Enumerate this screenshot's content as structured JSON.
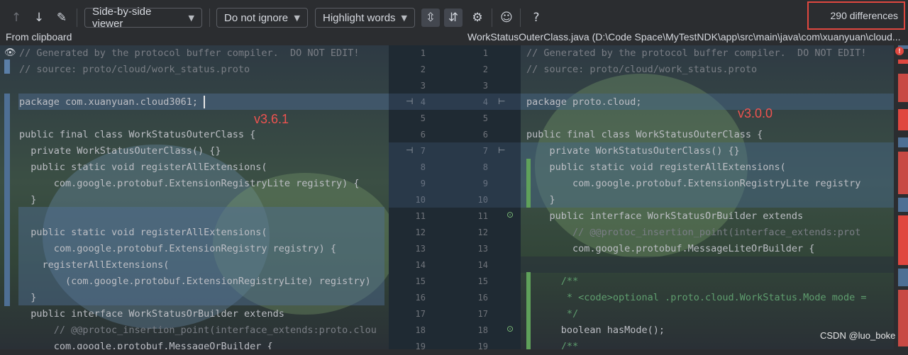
{
  "toolbar": {
    "prev_icon": "arrow-up-icon",
    "next_icon": "arrow-down-icon",
    "edit_icon": "pencil-icon",
    "viewer_mode": "Side-by-side viewer",
    "ignore_mode": "Do not ignore",
    "highlight_mode": "Highlight words",
    "collapse_icon": "collapse-unchanged-icon",
    "sync_scroll_icon": "sync-scroll-icon",
    "settings_icon": "gear-icon",
    "annotate_icon": "annotate-icon",
    "help_label": "?"
  },
  "differences_label": "290 differences",
  "left_header": "From clipboard",
  "right_header": "WorkStatusOuterClass.java (D:\\Code Space\\MyTestNDK\\app\\src\\main\\java\\com\\xuanyuan\\cloud...",
  "left_version": "v3.6.1",
  "right_version": "v3.0.0",
  "left_lines": [
    "// Generated by the protocol buffer compiler.  DO NOT EDIT!",
    "// source: proto/cloud/work_status.proto",
    "",
    "package com.xuanyuan.cloud3061;",
    "",
    "public final class WorkStatusOuterClass {",
    "  private WorkStatusOuterClass() {}",
    "  public static void registerAllExtensions(",
    "      com.google.protobuf.ExtensionRegistryLite registry) {",
    "  }",
    "",
    "  public static void registerAllExtensions(",
    "      com.google.protobuf.ExtensionRegistry registry) {",
    "    registerAllExtensions(",
    "        (com.google.protobuf.ExtensionRegistryLite) registry)",
    "  }",
    "  public interface WorkStatusOrBuilder extends",
    "      // @@protoc_insertion_point(interface_extends:proto.clou",
    "      com.google.protobuf.MessageOrBuilder {"
  ],
  "right_lines": [
    "// Generated by the protocol buffer compiler.  DO NOT EDIT!",
    "// source: proto/cloud/work_status.proto",
    "",
    "package proto.cloud;",
    "",
    "public final class WorkStatusOuterClass {",
    "    private WorkStatusOuterClass() {}",
    "    public static void registerAllExtensions(",
    "        com.google.protobuf.ExtensionRegistryLite registry",
    "    }",
    "    public interface WorkStatusOrBuilder extends",
    "        // @@protoc_insertion_point(interface_extends:prot",
    "        com.google.protobuf.MessageLiteOrBuilder {",
    "",
    "      /**",
    "       * <code>optional .proto.cloud.WorkStatus.Mode mode =",
    "       */",
    "      boolean hasMode();",
    "      /**"
  ],
  "left_numbers": [
    "1",
    "2",
    "3",
    "4",
    "5",
    "6",
    "7",
    "8",
    "9",
    "10",
    "11",
    "12",
    "13",
    "14",
    "15",
    "16",
    "17",
    "18",
    "19"
  ],
  "right_numbers": [
    "1",
    "2",
    "3",
    "4",
    "5",
    "6",
    "7",
    "8",
    "9",
    "10",
    "11",
    "12",
    "13",
    "14",
    "15",
    "16",
    "17",
    "18",
    "19"
  ],
  "watermark": "CSDN @luo_boke",
  "colors": {
    "accent_red": "#e0473f",
    "background": "#2b2d30"
  }
}
